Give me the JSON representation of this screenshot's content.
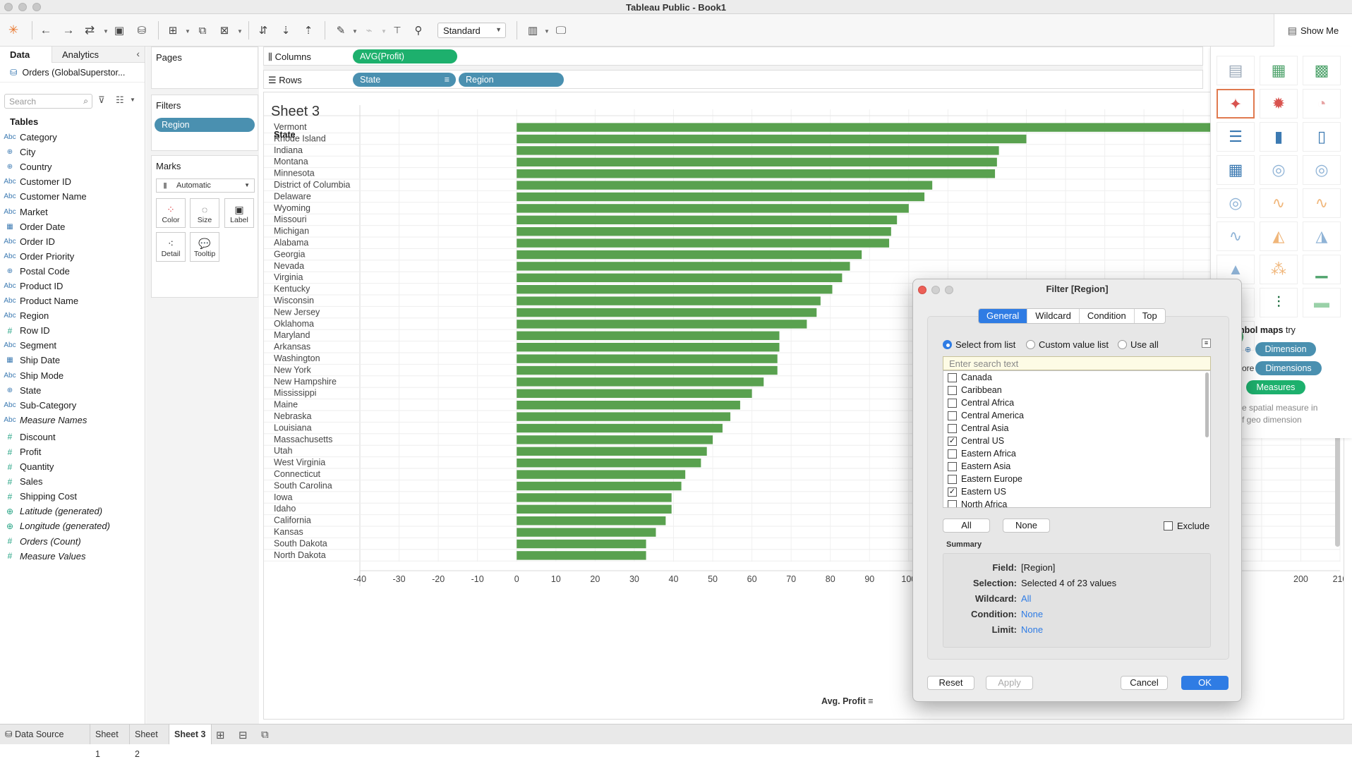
{
  "window": {
    "title": "Tableau Public - Book1"
  },
  "toolbar": {
    "mode_select": "Standard",
    "show_me": "Show Me"
  },
  "data_pane": {
    "tab_data": "Data",
    "tab_analytics": "Analytics",
    "source": "Orders (GlobalSuperstor...",
    "search_placeholder": "Search",
    "tables_header": "Tables",
    "dimensions": [
      {
        "name": "Category",
        "icon": "Abc"
      },
      {
        "name": "City",
        "icon": "globe"
      },
      {
        "name": "Country",
        "icon": "globe"
      },
      {
        "name": "Customer ID",
        "icon": "Abc"
      },
      {
        "name": "Customer Name",
        "icon": "Abc"
      },
      {
        "name": "Market",
        "icon": "Abc"
      },
      {
        "name": "Order Date",
        "icon": "calendar"
      },
      {
        "name": "Order ID",
        "icon": "Abc"
      },
      {
        "name": "Order Priority",
        "icon": "Abc"
      },
      {
        "name": "Postal Code",
        "icon": "globe"
      },
      {
        "name": "Product ID",
        "icon": "Abc"
      },
      {
        "name": "Product Name",
        "icon": "Abc"
      },
      {
        "name": "Region",
        "icon": "Abc"
      },
      {
        "name": "Row ID",
        "icon": "#"
      },
      {
        "name": "Segment",
        "icon": "Abc"
      },
      {
        "name": "Ship Date",
        "icon": "calendar"
      },
      {
        "name": "Ship Mode",
        "icon": "Abc"
      },
      {
        "name": "State",
        "icon": "globe"
      },
      {
        "name": "Sub-Category",
        "icon": "Abc"
      },
      {
        "name": "Measure Names",
        "icon": "Abc",
        "italic": true
      }
    ],
    "measures": [
      {
        "name": "Discount",
        "icon": "#"
      },
      {
        "name": "Profit",
        "icon": "#"
      },
      {
        "name": "Quantity",
        "icon": "#"
      },
      {
        "name": "Sales",
        "icon": "#"
      },
      {
        "name": "Shipping Cost",
        "icon": "#"
      },
      {
        "name": "Latitude (generated)",
        "icon": "globe",
        "italic": true
      },
      {
        "name": "Longitude (generated)",
        "icon": "globe",
        "italic": true
      },
      {
        "name": "Orders (Count)",
        "icon": "#",
        "italic": true
      },
      {
        "name": "Measure Values",
        "icon": "#",
        "italic": true
      }
    ]
  },
  "cards": {
    "pages": "Pages",
    "filters": "Filters",
    "filter_pill": "Region",
    "marks": "Marks",
    "mark_type": "Automatic",
    "mark_buttons": [
      "Color",
      "Size",
      "Label",
      "Detail",
      "Tooltip"
    ]
  },
  "shelves": {
    "columns_label": "Columns",
    "rows_label": "Rows",
    "columns_pill": "AVG(Profit)",
    "rows_pills": [
      "State",
      "Region"
    ]
  },
  "sheet": {
    "title": "Sheet 3",
    "row_header": "State",
    "x_axis_title": "Avg. Profit"
  },
  "chart_data": {
    "type": "bar",
    "orientation": "horizontal",
    "bar_color": "#59a14f",
    "xlabel": "Avg. Profit",
    "ylabel": "State",
    "xlim": [
      -40,
      210
    ],
    "x_ticks": [
      -40,
      -30,
      -20,
      -10,
      0,
      10,
      20,
      30,
      40,
      50,
      60,
      70,
      80,
      90,
      100,
      110,
      120,
      130,
      140,
      150,
      160,
      170,
      180,
      190,
      200,
      210
    ],
    "visible_x_ticks": [
      "-40",
      "-30",
      "-20",
      "-10",
      "0",
      "10",
      "20",
      "30",
      "40",
      "50",
      "60",
      "70",
      "80",
      "90",
      "100",
      "200",
      "210"
    ],
    "categories": [
      "Vermont",
      "Rhode Island",
      "Indiana",
      "Montana",
      "Minnesota",
      "District of Columbia",
      "Delaware",
      "Wyoming",
      "Missouri",
      "Michigan",
      "Alabama",
      "Georgia",
      "Nevada",
      "Virginia",
      "Kentucky",
      "Wisconsin",
      "New Jersey",
      "Oklahoma",
      "Maryland",
      "Arkansas",
      "Washington",
      "New York",
      "New Hampshire",
      "Mississippi",
      "Maine",
      "Nebraska",
      "Louisiana",
      "Massachusetts",
      "Utah",
      "West Virginia",
      "Connecticut",
      "South Carolina",
      "Iowa",
      "Idaho",
      "California",
      "Kansas",
      "South Dakota",
      "North Dakota"
    ],
    "values": [
      182,
      130,
      123,
      122.5,
      122,
      106,
      104,
      100,
      97,
      95.5,
      95,
      88,
      85,
      83,
      80.5,
      77.5,
      76.5,
      74,
      67,
      67,
      66.5,
      66.5,
      63,
      60,
      57,
      54.5,
      52.5,
      50,
      48.5,
      47,
      43,
      42,
      39.5,
      39.5,
      38,
      35.5,
      33,
      33
    ]
  },
  "show_me": {
    "hint_bold": "nbol maps",
    "hint_rest": " try",
    "pill1": "Dimension",
    "pill2_prefix": "ore",
    "pill2": "Dimensions",
    "pill3": "Measures",
    "desc1": "e spatial measure in",
    "desc2": "f geo dimension"
  },
  "filter_dialog": {
    "title": "Filter [Region]",
    "tabs": [
      "General",
      "Wildcard",
      "Condition",
      "Top"
    ],
    "radio_options": [
      "Select from list",
      "Custom value list",
      "Use all"
    ],
    "search_placeholder": "Enter search text",
    "items": [
      {
        "label": "Canada",
        "checked": false
      },
      {
        "label": "Caribbean",
        "checked": false
      },
      {
        "label": "Central Africa",
        "checked": false
      },
      {
        "label": "Central America",
        "checked": false
      },
      {
        "label": "Central Asia",
        "checked": false
      },
      {
        "label": "Central US",
        "checked": true
      },
      {
        "label": "Eastern Africa",
        "checked": false
      },
      {
        "label": "Eastern Asia",
        "checked": false
      },
      {
        "label": "Eastern Europe",
        "checked": false
      },
      {
        "label": "Eastern US",
        "checked": true
      },
      {
        "label": "North Africa",
        "checked": false
      }
    ],
    "btn_all": "All",
    "btn_none": "None",
    "exclude": "Exclude",
    "summary_label": "Summary",
    "summary": [
      {
        "key": "Field:",
        "value": "[Region]",
        "link": false
      },
      {
        "key": "Selection:",
        "value": "Selected 4 of 23 values",
        "link": false
      },
      {
        "key": "Wildcard:",
        "value": "All",
        "link": true
      },
      {
        "key": "Condition:",
        "value": "None",
        "link": true
      },
      {
        "key": "Limit:",
        "value": "None",
        "link": true
      }
    ],
    "btn_reset": "Reset",
    "btn_apply": "Apply",
    "btn_cancel": "Cancel",
    "btn_ok": "OK"
  },
  "tabbar": {
    "data_source": "Data Source",
    "sheets": [
      "Sheet 1",
      "Sheet 2",
      "Sheet 3"
    ]
  }
}
